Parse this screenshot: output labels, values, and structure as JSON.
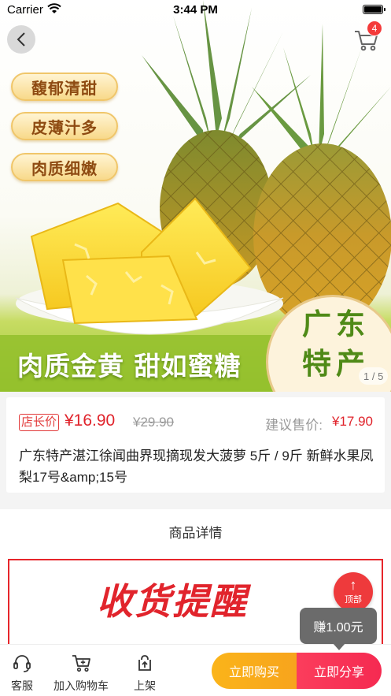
{
  "status_bar": {
    "carrier": "Carrier",
    "time": "3:44 PM"
  },
  "hero": {
    "cart_count": "4",
    "feature_tags": [
      "馥郁清甜",
      "皮薄汁多",
      "肉质细嫩"
    ],
    "slogan": "肉质金黄 甜如蜜糖",
    "badge_text": "广东特产",
    "page_indicator": "1 / 5"
  },
  "price_card": {
    "owner_tag": "店长价",
    "price": "¥16.90",
    "original_price": "¥29.90",
    "suggest_label": "建议售价:",
    "suggest_price": "¥17.90",
    "title": "广东特产湛江徐闻曲界现摘现发大菠萝 5斤 / 9斤 新鲜水果凤梨17号&amp;15号"
  },
  "details": {
    "heading": "商品详情",
    "image_text": "收货提醒"
  },
  "floating": {
    "top_label": "顶部",
    "earn_tip": "赚1.00元"
  },
  "bottom_bar": {
    "service_label": "客服",
    "add_cart_label": "加入购物车",
    "shelf_label": "上架",
    "buy_label": "立即购买",
    "share_label": "立即分享"
  },
  "colors": {
    "accent_red": "#e0232b",
    "buy_orange": "#f7a41d",
    "share_pink": "#f52a51",
    "green": "#4f8a17"
  }
}
